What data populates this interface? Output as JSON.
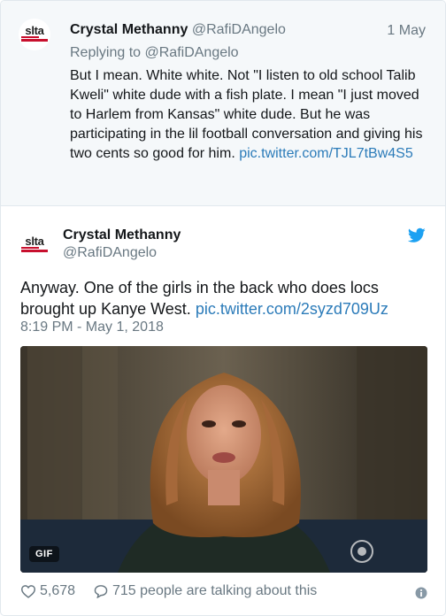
{
  "reply_tweet": {
    "author_name": "Crystal Methanny",
    "author_handle": "@RafiDAngelo",
    "date": "1 May",
    "replying_to": "Replying to @RafiDAngelo",
    "text": "But I mean.  White white. Not \"I listen to old school Talib Kweli\" white dude with a fish plate. I mean \"I just moved to Harlem from Kansas\" white dude. But he was participating in the lil football conversation and giving his two cents so good for him.",
    "link": "pic.twitter.com/TJL7tBw4S5",
    "avatar_logo": "slta"
  },
  "main_tweet": {
    "author_name": "Crystal Methanny",
    "author_handle": "@RafiDAngelo",
    "text": "Anyway. One of the girls in the back who does locs brought up Kanye West.",
    "link": "pic.twitter.com/2syzd709Uz",
    "timestamp": "8:19 PM - May 1, 2018",
    "gif_label": "GIF",
    "avatar_logo": "slta"
  },
  "footer": {
    "likes": "5,678",
    "talking": "715 people are talking about this"
  },
  "icons": {
    "bird": "twitter-bird-icon",
    "heart": "heart-icon",
    "comment": "comment-icon",
    "info": "info-icon"
  },
  "colors": {
    "link": "#2b7bb9",
    "muted": "#697882",
    "twitter_blue": "#1da1f2",
    "logo_red": "#c8102e"
  }
}
